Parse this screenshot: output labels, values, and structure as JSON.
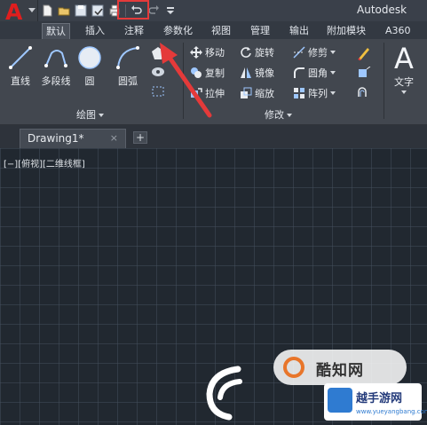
{
  "titlebar": {
    "app_button_letter": "A",
    "title": "Autodesk",
    "qat_icons": [
      "new-icon",
      "open-icon",
      "save-icon",
      "saveas-icon",
      "print-icon",
      "undo-icon",
      "redo-icon",
      "customize-icon"
    ]
  },
  "ribbon": {
    "tabs": [
      {
        "label": "默认",
        "active": true
      },
      {
        "label": "插入",
        "active": false
      },
      {
        "label": "注释",
        "active": false
      },
      {
        "label": "参数化",
        "active": false
      },
      {
        "label": "视图",
        "active": false
      },
      {
        "label": "管理",
        "active": false
      },
      {
        "label": "输出",
        "active": false
      },
      {
        "label": "附加模块",
        "active": false
      },
      {
        "label": "A360",
        "active": false
      }
    ],
    "draw": {
      "line": "直线",
      "polyline": "多段线",
      "circle": "圆",
      "arc": "圆弧",
      "group_label": "绘图"
    },
    "modify": {
      "move": "移动",
      "rotate": "旋转",
      "trim": "修剪",
      "copy": "复制",
      "mirror": "镜像",
      "fillet": "圆角",
      "stretch": "拉伸",
      "scale": "缩放",
      "array": "阵列",
      "group_label": "修改"
    },
    "text": {
      "big_letter": "A",
      "label": "文字"
    }
  },
  "document": {
    "tab_name": "Drawing1*",
    "close_glyph": "×",
    "new_tab_glyph": "+"
  },
  "viewport": {
    "label": "[−][俯视][二维线框]"
  },
  "watermark": {
    "kuzhi": "酷知网",
    "brand": "越手游网",
    "url": "www.yueyangbang.com"
  },
  "colors": {
    "accent_red": "#e43a3a",
    "app_logo_red": "#e01e1e"
  }
}
